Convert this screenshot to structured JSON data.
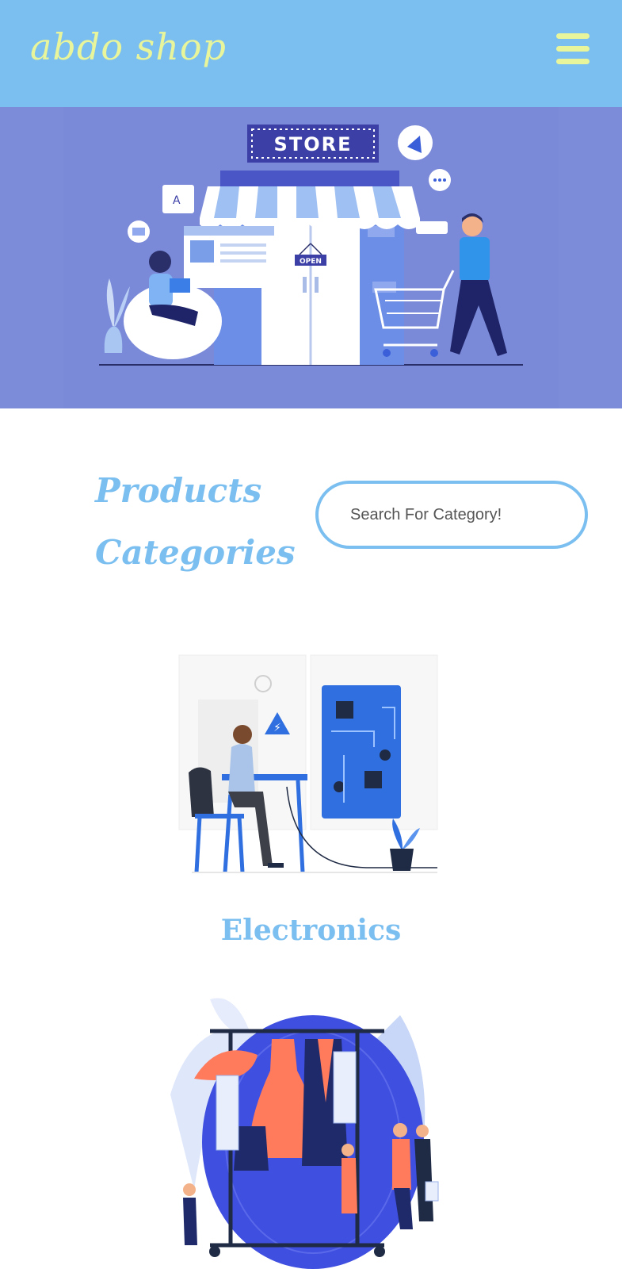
{
  "header": {
    "brand": "abdo shop",
    "menu_icon": "hamburger-menu-icon",
    "colors": {
      "background": "#7bbff0",
      "accent": "#e8f59a"
    }
  },
  "hero": {
    "store_sign": "STORE",
    "door_sign": "OPEN",
    "background": "#7d8cd9"
  },
  "categories_section": {
    "title_line1": "Products",
    "title_line2": "Categories",
    "search_placeholder": "Search For Category!",
    "items": [
      {
        "label": "Electronics"
      }
    ]
  }
}
